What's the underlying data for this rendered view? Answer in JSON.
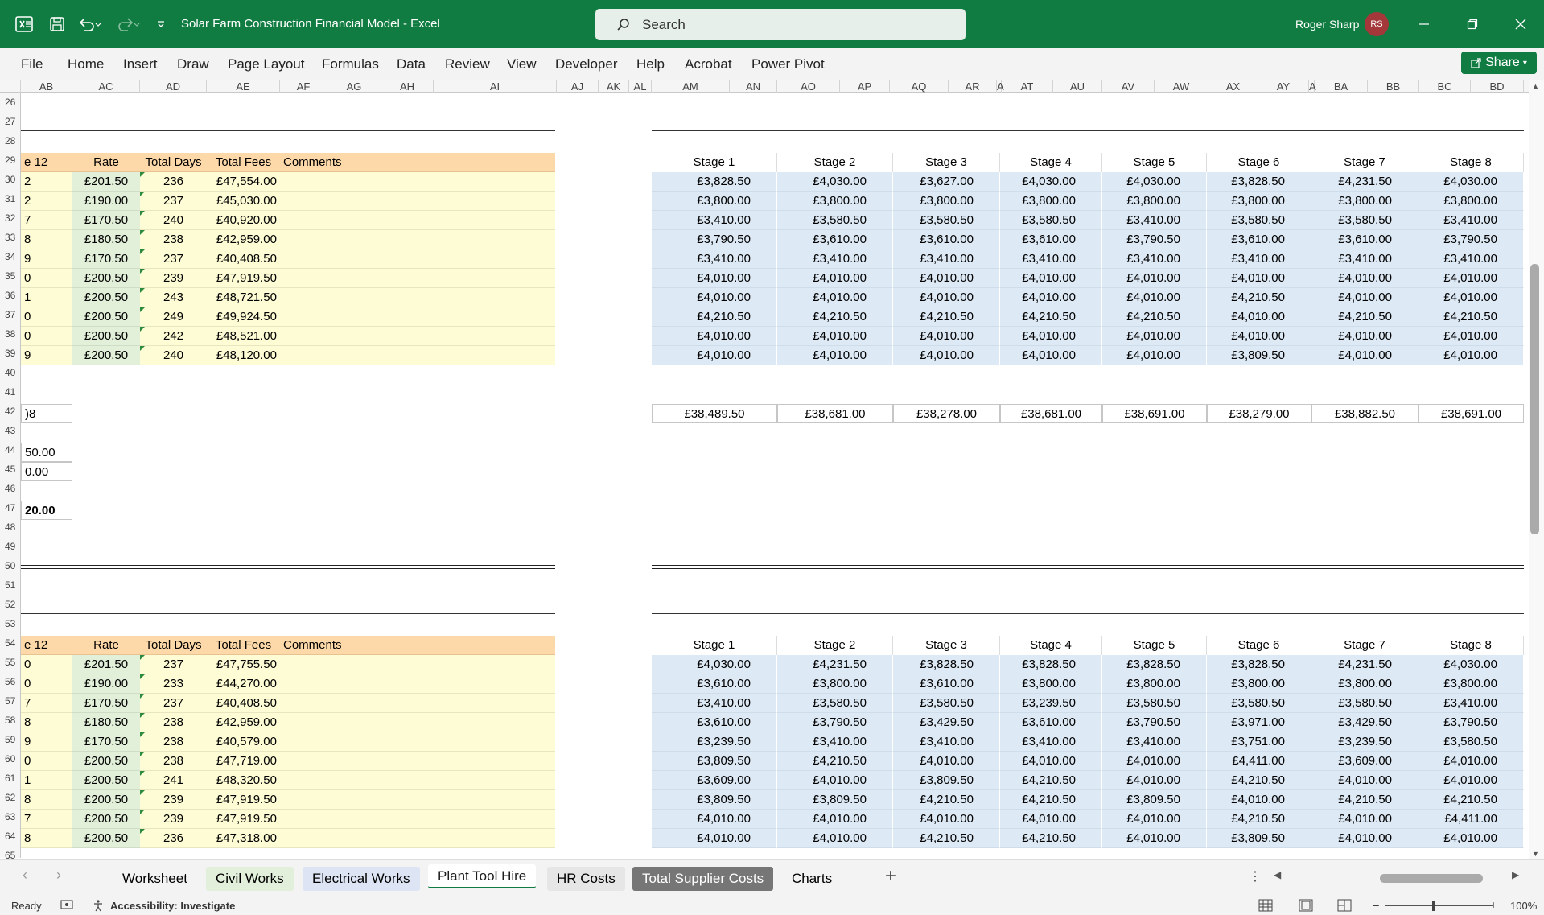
{
  "titlebar": {
    "doc_title": "Solar Farm Construction Financial Model  -  Excel",
    "search_placeholder": "Search",
    "user_name": "Roger Sharp",
    "user_initials": "RS"
  },
  "menu": [
    "File",
    "Home",
    "Insert",
    "Draw",
    "Page Layout",
    "Formulas",
    "Data",
    "Review",
    "View",
    "Developer",
    "Help",
    "Acrobat",
    "Power Pivot"
  ],
  "share_label": "Share",
  "columns": [
    "AB",
    "AC",
    "AD",
    "AE",
    "AF",
    "AG",
    "AH",
    "AI",
    "AJ",
    "AK",
    "AL",
    "AM",
    "AN",
    "AO",
    "AP",
    "AQ",
    "AR",
    "A",
    "AT",
    "AU",
    "AV",
    "AW",
    "AX",
    "AY",
    "A",
    "BA",
    "BB",
    "BC",
    "BD"
  ],
  "rows": [
    "26",
    "27",
    "28",
    "29",
    "30",
    "31",
    "32",
    "33",
    "34",
    "35",
    "36",
    "37",
    "38",
    "39",
    "40",
    "41",
    "42",
    "43",
    "44",
    "45",
    "46",
    "47",
    "48",
    "49",
    "50",
    "51",
    "52",
    "53",
    "54",
    "55",
    "56",
    "57",
    "58",
    "59",
    "60",
    "61",
    "62",
    "63",
    "64",
    "65"
  ],
  "left_headers": [
    "e 12",
    "Rate",
    "Total Days",
    "Total Fees",
    "Comments"
  ],
  "stage_headers": [
    "Stage 1",
    "Stage 2",
    "Stage 3",
    "Stage 4",
    "Stage 5",
    "Stage 6",
    "Stage 7",
    "Stage 8"
  ],
  "table1": {
    "left_rows": [
      [
        "2",
        "£201.50",
        "236",
        "£47,554.00"
      ],
      [
        "2",
        "£190.00",
        "237",
        "£45,030.00"
      ],
      [
        "7",
        "£170.50",
        "240",
        "£40,920.00"
      ],
      [
        "8",
        "£180.50",
        "238",
        "£42,959.00"
      ],
      [
        "9",
        "£170.50",
        "237",
        "£40,408.50"
      ],
      [
        "0",
        "£200.50",
        "239",
        "£47,919.50"
      ],
      [
        "1",
        "£200.50",
        "243",
        "£48,721.50"
      ],
      [
        "0",
        "£200.50",
        "249",
        "£49,924.50"
      ],
      [
        "0",
        "£200.50",
        "242",
        "£48,521.00"
      ],
      [
        "9",
        "£200.50",
        "240",
        "£48,120.00"
      ]
    ],
    "stage_rows": [
      [
        "£3,828.50",
        "£4,030.00",
        "£3,627.00",
        "£4,030.00",
        "£4,030.00",
        "£3,828.50",
        "£4,231.50",
        "£4,030.00"
      ],
      [
        "£3,800.00",
        "£3,800.00",
        "£3,800.00",
        "£3,800.00",
        "£3,800.00",
        "£3,800.00",
        "£3,800.00",
        "£3,800.00"
      ],
      [
        "£3,410.00",
        "£3,580.50",
        "£3,580.50",
        "£3,580.50",
        "£3,410.00",
        "£3,580.50",
        "£3,580.50",
        "£3,410.00"
      ],
      [
        "£3,790.50",
        "£3,610.00",
        "£3,610.00",
        "£3,610.00",
        "£3,790.50",
        "£3,610.00",
        "£3,610.00",
        "£3,790.50"
      ],
      [
        "£3,410.00",
        "£3,410.00",
        "£3,410.00",
        "£3,410.00",
        "£3,410.00",
        "£3,410.00",
        "£3,410.00",
        "£3,410.00"
      ],
      [
        "£4,010.00",
        "£4,010.00",
        "£4,010.00",
        "£4,010.00",
        "£4,010.00",
        "£4,010.00",
        "£4,010.00",
        "£4,010.00"
      ],
      [
        "£4,010.00",
        "£4,010.00",
        "£4,010.00",
        "£4,010.00",
        "£4,010.00",
        "£4,210.50",
        "£4,010.00",
        "£4,010.00"
      ],
      [
        "£4,210.50",
        "£4,210.50",
        "£4,210.50",
        "£4,210.50",
        "£4,210.50",
        "£4,010.00",
        "£4,210.50",
        "£4,210.50"
      ],
      [
        "£4,010.00",
        "£4,010.00",
        "£4,010.00",
        "£4,010.00",
        "£4,010.00",
        "£4,010.00",
        "£4,010.00",
        "£4,010.00"
      ],
      [
        "£4,010.00",
        "£4,010.00",
        "£4,010.00",
        "£4,010.00",
        "£4,010.00",
        "£3,809.50",
        "£4,010.00",
        "£4,010.00"
      ]
    ],
    "stage_totals": [
      "£38,489.50",
      "£38,681.00",
      "£38,278.00",
      "£38,681.00",
      "£38,691.00",
      "£38,279.00",
      "£38,882.50",
      "£38,691.00"
    ],
    "side_values": {
      "r42": ")8",
      "r44": "50.00",
      "r45": "0.00",
      "r47": "20.00"
    }
  },
  "table2": {
    "left_rows": [
      [
        "0",
        "£201.50",
        "237",
        "£47,755.50"
      ],
      [
        "0",
        "£190.00",
        "233",
        "£44,270.00"
      ],
      [
        "7",
        "£170.50",
        "237",
        "£40,408.50"
      ],
      [
        "8",
        "£180.50",
        "238",
        "£42,959.00"
      ],
      [
        "9",
        "£170.50",
        "238",
        "£40,579.00"
      ],
      [
        "0",
        "£200.50",
        "238",
        "£47,719.00"
      ],
      [
        "1",
        "£200.50",
        "241",
        "£48,320.50"
      ],
      [
        "8",
        "£200.50",
        "239",
        "£47,919.50"
      ],
      [
        "7",
        "£200.50",
        "239",
        "£47,919.50"
      ],
      [
        "8",
        "£200.50",
        "236",
        "£47,318.00"
      ]
    ],
    "stage_rows": [
      [
        "£4,030.00",
        "£4,231.50",
        "£3,828.50",
        "£3,828.50",
        "£3,828.50",
        "£3,828.50",
        "£4,231.50",
        "£4,030.00"
      ],
      [
        "£3,610.00",
        "£3,800.00",
        "£3,610.00",
        "£3,800.00",
        "£3,800.00",
        "£3,800.00",
        "£3,800.00",
        "£3,800.00"
      ],
      [
        "£3,410.00",
        "£3,580.50",
        "£3,580.50",
        "£3,239.50",
        "£3,580.50",
        "£3,580.50",
        "£3,580.50",
        "£3,410.00"
      ],
      [
        "£3,610.00",
        "£3,790.50",
        "£3,429.50",
        "£3,610.00",
        "£3,790.50",
        "£3,971.00",
        "£3,429.50",
        "£3,790.50"
      ],
      [
        "£3,239.50",
        "£3,410.00",
        "£3,410.00",
        "£3,410.00",
        "£3,410.00",
        "£3,751.00",
        "£3,239.50",
        "£3,580.50"
      ],
      [
        "£3,809.50",
        "£4,210.50",
        "£4,010.00",
        "£4,010.00",
        "£4,010.00",
        "£4,411.00",
        "£3,609.00",
        "£4,010.00"
      ],
      [
        "£3,609.00",
        "£4,010.00",
        "£3,809.50",
        "£4,210.50",
        "£4,010.00",
        "£4,210.50",
        "£4,010.00",
        "£4,010.00"
      ],
      [
        "£3,809.50",
        "£3,809.50",
        "£4,210.50",
        "£4,210.50",
        "£3,809.50",
        "£4,010.00",
        "£4,210.50",
        "£4,210.50"
      ],
      [
        "£4,010.00",
        "£4,010.00",
        "£4,010.00",
        "£4,010.00",
        "£4,010.00",
        "£4,210.50",
        "£4,010.00",
        "£4,411.00"
      ],
      [
        "£4,010.00",
        "£4,010.00",
        "£4,210.50",
        "£4,210.50",
        "£4,010.00",
        "£3,809.50",
        "£4,010.00",
        "£4,010.00"
      ]
    ]
  },
  "sheet_tabs": [
    {
      "label": "Worksheet",
      "bg": "#f3f3f3"
    },
    {
      "label": "Civil Works",
      "bg": "#e2efda"
    },
    {
      "label": "Electrical Works",
      "bg": "#dde4f3"
    },
    {
      "label": "Plant Tool Hire",
      "bg": "#ffffff"
    },
    {
      "label": "HR Costs",
      "bg": "#e6e6e6"
    },
    {
      "label": "Total Supplier Costs",
      "bg": "#767676"
    },
    {
      "label": "Charts",
      "bg": "#f3f3f3"
    }
  ],
  "status": {
    "ready": "Ready",
    "accessibility": "Accessibility: Investigate",
    "zoom": "100%"
  }
}
